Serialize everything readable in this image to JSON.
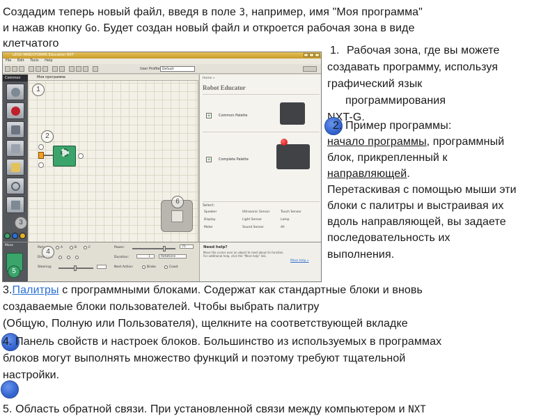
{
  "intro": {
    "line1_pre": "Создадим теперь новый файл, введя в поле ",
    "line1_num": "3",
    "line1_post": ", например, имя \"Моя программа\"",
    "line2_pre": "и нажав кнопку ",
    "line2_go": "Go",
    "line2_post": ". Будет создан новый файл и откроется рабочая зона в виде",
    "line3": "клетчатого"
  },
  "note1": {
    "num": "1.",
    "l1": "Рабочая зона, где вы можете",
    "l2": "создавать программу, используя",
    "l3": "графический язык",
    "l4": "программирования",
    "l5": "NXT-G."
  },
  "note2": {
    "l1": "2. Пример программы:",
    "l2_u": "начало программы",
    "l2_rest": ", программный",
    "l3": "блок, прикрепленный к",
    "l4_u": "направляющей",
    "l4_rest": ".",
    "l5": "Перетаскивая с помощью мыши эти",
    "l6": " блоки с палитры и выстраивая их",
    "l7": "вдоль направляющей, вы задаете",
    "l8": "последовательность их",
    "l9": "выполнения."
  },
  "note3": {
    "num": "3.",
    "link": "Палитры",
    "rest": " с программными блоками. Содержат как стандартные блоки и вновь",
    "l2": "создаваемые блоки пользователей. Чтобы выбрать палитру",
    "l3": " (Общую, Полную или Пользователя), щелкните на соответствующей вкладке"
  },
  "note4": {
    "l1": "4. Панель свойств и настроек блоков. Большинство из используемых в программах",
    "l2": "блоков могут выполнять множество функций и поэтому требуют тщательной",
    "l3": "настройки."
  },
  "note5": {
    "l1_pre": "5. Область обратной связи. При установленной связи между компьютером и ",
    "l1_nxt": "NXT"
  },
  "app": {
    "title": "LEGO MINDSTORMS Education NXT",
    "menu": [
      "File",
      "Edit",
      "Tools",
      "Help"
    ],
    "user_profile_label": "User Profile:",
    "user_profile_value": "Default",
    "palette_header": "Common",
    "canvas_tab": "Моя программа",
    "canvas_numbers": [
      "1",
      "2",
      "3",
      "4",
      "5",
      "6"
    ],
    "robot": {
      "crumb": "Home »",
      "title": "Robot Educator",
      "common_palette": "Common Palette",
      "complete_palette": "Complete Palette",
      "select_label": "Select:",
      "sensors": [
        "Speaker",
        "Ultrasonic Sensor",
        "Touch Sensor",
        "Display",
        "Light Sensor",
        "Lamp",
        "Motor",
        "Sound Sensor",
        "All"
      ]
    },
    "props": {
      "mote_label": "Move",
      "port": "Port:",
      "port_a": "A",
      "port_b": "B",
      "port_c": "C",
      "direction": "Direction:",
      "steering": "Steering:",
      "power": "Power:",
      "power_value": "75",
      "duration": "Duration:",
      "duration_value": "1",
      "duration_unit": "Rotations",
      "next_action": "Next Action:",
      "brake": "Brake",
      "coast": "Coast"
    },
    "help": {
      "title": "Need help?",
      "body": "Move the cursor over an object to read about its function. For additional help, click the \"More help\" link.",
      "more": "More help »"
    }
  }
}
